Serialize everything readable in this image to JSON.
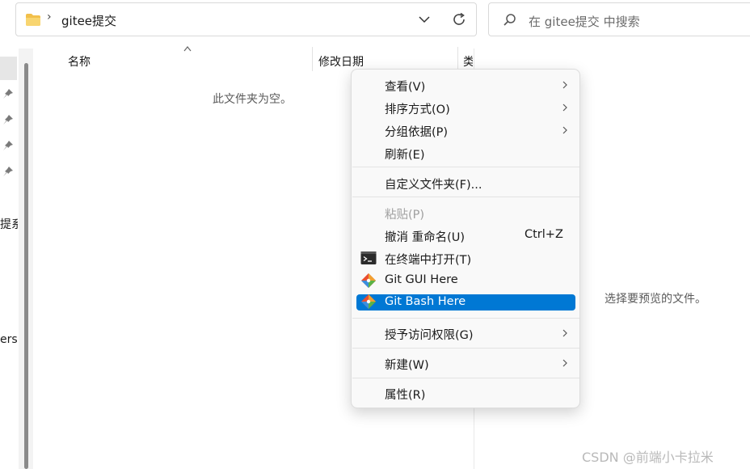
{
  "address_bar": {
    "path_label": "gitee提交"
  },
  "search": {
    "placeholder": "在 gitee提交 中搜索"
  },
  "nav": {
    "partial_item_1": "提系",
    "partial_item_2": "ersc"
  },
  "columns": {
    "name": "名称",
    "modified": "修改日期",
    "type_partial": "类"
  },
  "empty_message": "此文件夹为空。",
  "preview_message": "选择要预览的文件。",
  "context_menu": {
    "view": "查看(V)",
    "sort": "排序方式(O)",
    "group": "分组依据(P)",
    "refresh": "刷新(E)",
    "customize": "自定义文件夹(F)...",
    "paste": "粘贴(P)",
    "undo": "撤消 重命名(U)",
    "undo_shortcut": "Ctrl+Z",
    "terminal": "在终端中打开(T)",
    "git_gui": "Git GUI Here",
    "git_bash": "Git Bash Here",
    "grant_access": "授予访问权限(G)",
    "new": "新建(W)",
    "properties": "属性(R)"
  },
  "watermark": "CSDN @前端小卡拉米",
  "colors": {
    "highlight": "#0078d4",
    "folder": "#f2c04b",
    "git": "#e94e31"
  }
}
